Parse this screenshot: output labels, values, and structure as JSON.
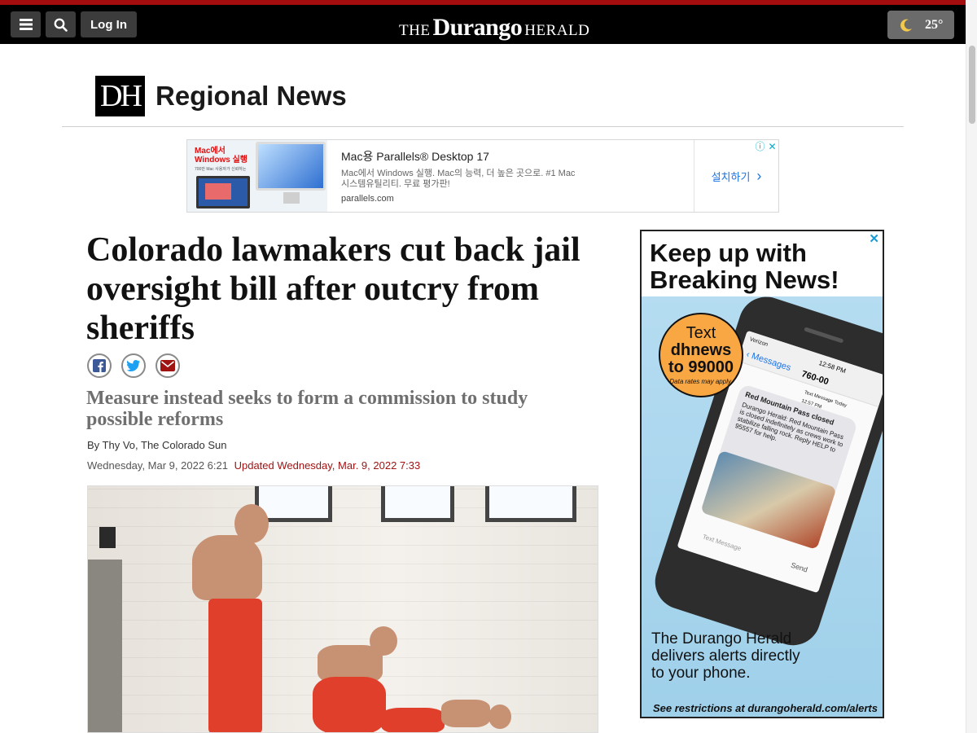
{
  "header": {
    "login_label": "Log In",
    "logo_prefix": "THE",
    "logo_main": "Durango",
    "logo_suffix": "HERALD",
    "weather_temp": "25°",
    "brand_bar_color": "#a30d0d"
  },
  "section": {
    "badge": "DH",
    "title": "Regional News"
  },
  "banner_ad": {
    "thumb_line1": "Mac에서",
    "thumb_line2": "Windows 실행",
    "thumb_small": "700만 Mac 사용자가 신뢰하는",
    "title": "Mac용 Parallels® Desktop 17",
    "description": "Mac에서 Windows 실행. Mac의 능력, 더 높은 곳으로. #1 Mac 시스템유틸리티. 무료 평가판!",
    "url": "parallels.com",
    "cta": "설치하기"
  },
  "article": {
    "headline": "Colorado lawmakers cut back jail oversight bill after outcry from sheriffs",
    "subhead": "Measure instead seeks to form a commission to study possible reforms",
    "byline": "By Thy Vo, The Colorado Sun",
    "published": "Wednesday, Mar 9, 2022 6:21",
    "updated": "Updated Wednesday, Mar. 9, 2022 7:33"
  },
  "side_ad": {
    "headline": "Keep up with Breaking News!",
    "badge_l1": "Text",
    "badge_l2": "dhnews",
    "badge_l3": "to 99000",
    "badge_note": "Data rates may apply.",
    "phone_carrier": "Verizon",
    "phone_time": "12:58 PM",
    "phone_back": "Messages",
    "phone_number": "760-00",
    "phone_msg_meta": "Text Message Today 12:57 PM",
    "phone_msg_title": "Red Mountain Pass closed",
    "phone_msg_body": "Durango Herald: Red Mountain Pass is closed indefinitely as crews work to stabilize falling rock. Reply HELP to 95557 for help.",
    "phone_input_placeholder": "Text Message",
    "phone_send": "Send",
    "footer": "The Durango Herald delivers alerts directly to your phone.",
    "restrictions": "See restrictions at durangoherald.com/alerts"
  }
}
